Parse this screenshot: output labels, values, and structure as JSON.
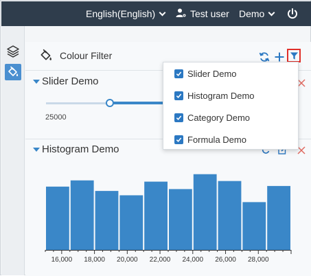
{
  "topbar": {
    "language_label": "English(English)",
    "user_label": "Test user",
    "project_label": "Demo"
  },
  "filter_panel": {
    "title": "Colour Filter"
  },
  "filter_menu": {
    "items": [
      {
        "label": "Slider Demo",
        "checked": true
      },
      {
        "label": "Histogram Demo",
        "checked": true
      },
      {
        "label": "Category Demo",
        "checked": true
      },
      {
        "label": "Formula Demo",
        "checked": true
      }
    ]
  },
  "slider_section": {
    "title": "Slider Demo",
    "min_label": "25000"
  },
  "histogram_section": {
    "title": "Histogram Demo"
  },
  "chart_data": {
    "type": "bar",
    "title": "",
    "xlabel": "",
    "ylabel": "",
    "x_tick_labels": [
      "16,000",
      "18,000",
      "20,000",
      "22,000",
      "24,000",
      "26,000",
      "28,000"
    ],
    "bins": [
      {
        "start": 15000,
        "end": 16500,
        "value": 102
      },
      {
        "start": 16500,
        "end": 18000,
        "value": 112
      },
      {
        "start": 18000,
        "end": 19500,
        "value": 95
      },
      {
        "start": 19500,
        "end": 21000,
        "value": 88
      },
      {
        "start": 21000,
        "end": 22500,
        "value": 110
      },
      {
        "start": 22500,
        "end": 24000,
        "value": 98
      },
      {
        "start": 24000,
        "end": 25500,
        "value": 122
      },
      {
        "start": 25500,
        "end": 27000,
        "value": 111
      },
      {
        "start": 27000,
        "end": 28500,
        "value": 77
      },
      {
        "start": 28500,
        "end": 30000,
        "value": 103
      }
    ],
    "colors": {
      "bar": "#3a87c8",
      "axis": "#333333"
    }
  }
}
